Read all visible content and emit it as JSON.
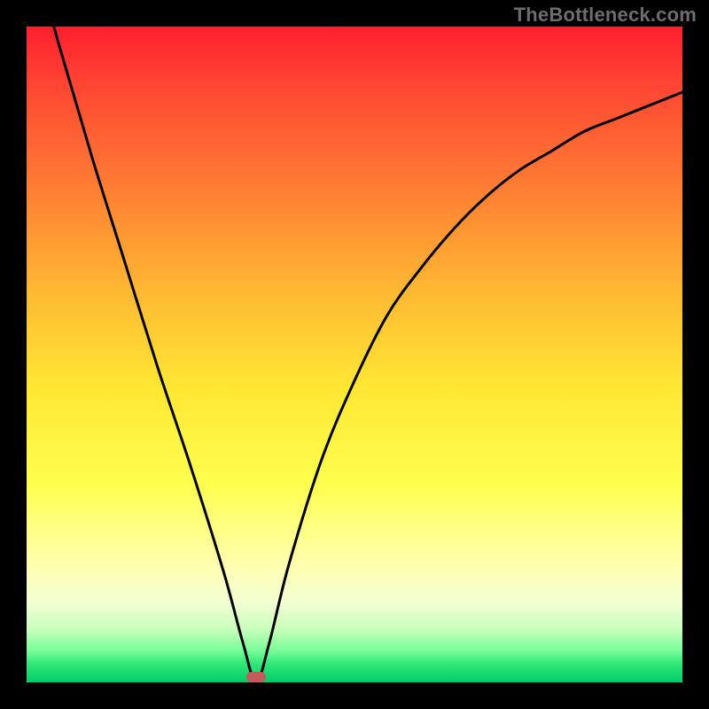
{
  "watermark": "TheBottleneck.com",
  "colors": {
    "frame_bg": "#000000",
    "curve": "#000000",
    "marker": "#c25b5b"
  },
  "chart_data": {
    "type": "line",
    "title": "",
    "xlabel": "",
    "ylabel": "",
    "xlim": [
      0,
      100
    ],
    "ylim": [
      0,
      100
    ],
    "notes": "V-shaped bottleneck curve; minimum near x≈35, y≈0. Values estimated from unlabeled plot.",
    "series": [
      {
        "name": "curve",
        "x": [
          0,
          5,
          10,
          15,
          20,
          25,
          30,
          33,
          35,
          37,
          40,
          45,
          50,
          55,
          60,
          65,
          70,
          75,
          80,
          85,
          90,
          95,
          100
        ],
        "values": [
          115,
          97,
          80,
          64,
          48,
          33,
          17,
          6,
          0,
          6,
          18,
          34,
          46,
          56,
          63,
          69,
          74,
          78,
          81,
          84,
          86,
          88,
          90
        ]
      }
    ],
    "marker": {
      "x": 35,
      "y": 0,
      "shape": "rounded-rect"
    }
  }
}
